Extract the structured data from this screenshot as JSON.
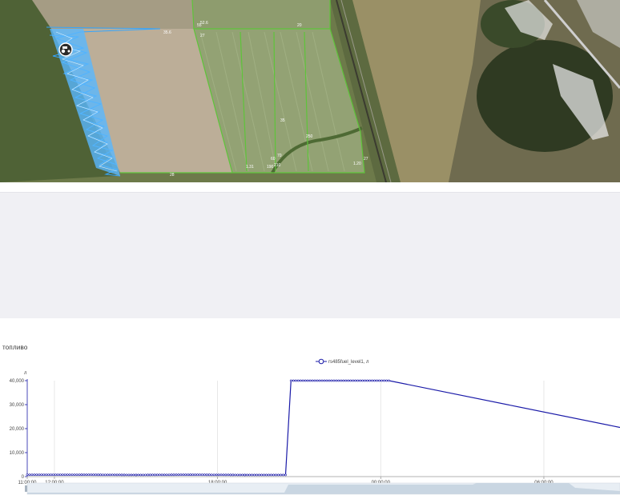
{
  "map": {
    "field_labels": [
      "35.6",
      "55",
      "20",
      "27",
      "35",
      "250",
      "70",
      "60",
      "190",
      "210",
      "1.31",
      "1.20",
      "27",
      "28",
      "52.6"
    ]
  },
  "chart": {
    "section_title": "топливо",
    "legend_label": "rs485fuel_level1, л",
    "y_unit": "л",
    "line_color": "#1a1aa8"
  },
  "chart_data": {
    "type": "line",
    "title": "топливо",
    "ylabel": "л",
    "xlabel": "",
    "ylim": [
      0,
      40000
    ],
    "y_ticks": [
      "0",
      "10,000",
      "20,000",
      "30,000",
      "40,000"
    ],
    "x_ticks": [
      "11:00:00",
      "12:00:00",
      "18:00:00",
      "00:00:00",
      "06:00:00"
    ],
    "x_tick_hours": [
      0,
      1,
      7,
      13,
      19
    ],
    "x_range_hours": [
      0,
      21.8
    ],
    "grid": true,
    "legend_position": "top-center",
    "series": [
      {
        "name": "rs485fuel_level1, л",
        "x_hours": [
          0,
          2,
          4,
          6,
          8,
          9.5,
          9.7,
          13.3,
          21.8
        ],
        "values": [
          800,
          800,
          700,
          800,
          700,
          700,
          40000,
          40000,
          20500
        ]
      }
    ]
  }
}
